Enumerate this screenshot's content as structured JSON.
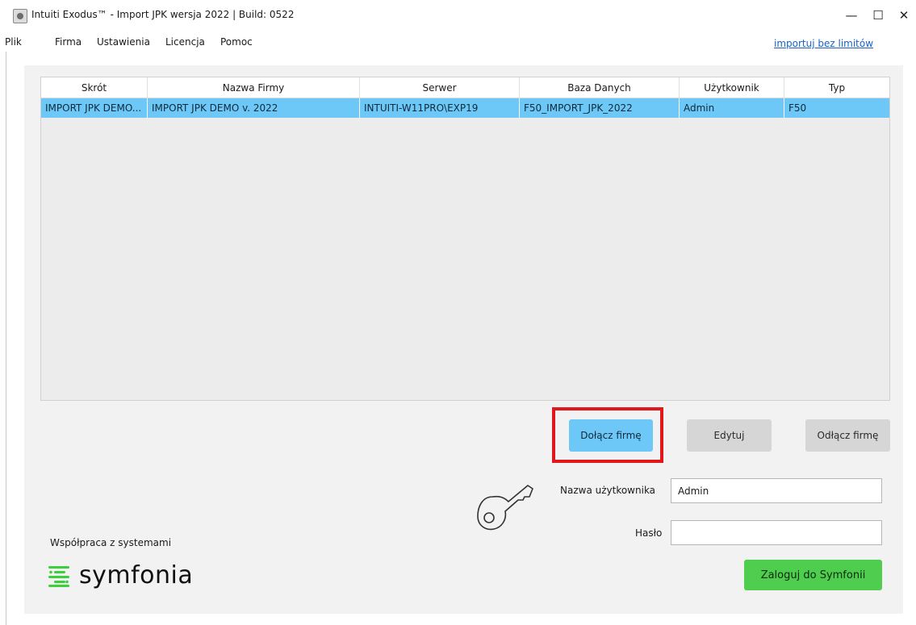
{
  "window": {
    "title": "Intuiti Exodus™ - Import JPK wersja 2022 | Build: 0522",
    "minimize": "—",
    "maximize": "☐",
    "close": "✕"
  },
  "menu": {
    "items": [
      "Plik",
      "Firma",
      "Ustawienia",
      "Licencja",
      "Pomoc"
    ],
    "link_no_limits": "importuj bez limitów"
  },
  "grid": {
    "columns": [
      "Skrót",
      "Nazwa Firmy",
      "Serwer",
      "Baza Danych",
      "Użytkownik",
      "Typ"
    ],
    "rows": [
      [
        "IMPORT JPK DEMO...",
        "IMPORT JPK DEMO v. 2022",
        "INTUITI-W11PRO\\EXP19",
        "F50_IMPORT_JPK_2022",
        "Admin",
        "F50"
      ]
    ],
    "selected_row_color": "#6ec8f7"
  },
  "buttons": {
    "attach": "Dołącz firmę",
    "edit": "Edytuj",
    "detach": "Odłącz firmę",
    "login": "Zaloguj do Symfonii"
  },
  "login": {
    "username_label": "Nazwa użytkownika",
    "username_value": "Admin",
    "password_label": "Hasło",
    "password_value": ""
  },
  "branding": {
    "cooperation_text": "Współpraca z systemami",
    "logo_text": "symfonia",
    "logo_color": "#3ccf3c"
  },
  "highlight_color": "#e0171b",
  "icons": {
    "app": "app-icon",
    "key": "key-icon",
    "logo": "symfonia-logo-icon"
  }
}
